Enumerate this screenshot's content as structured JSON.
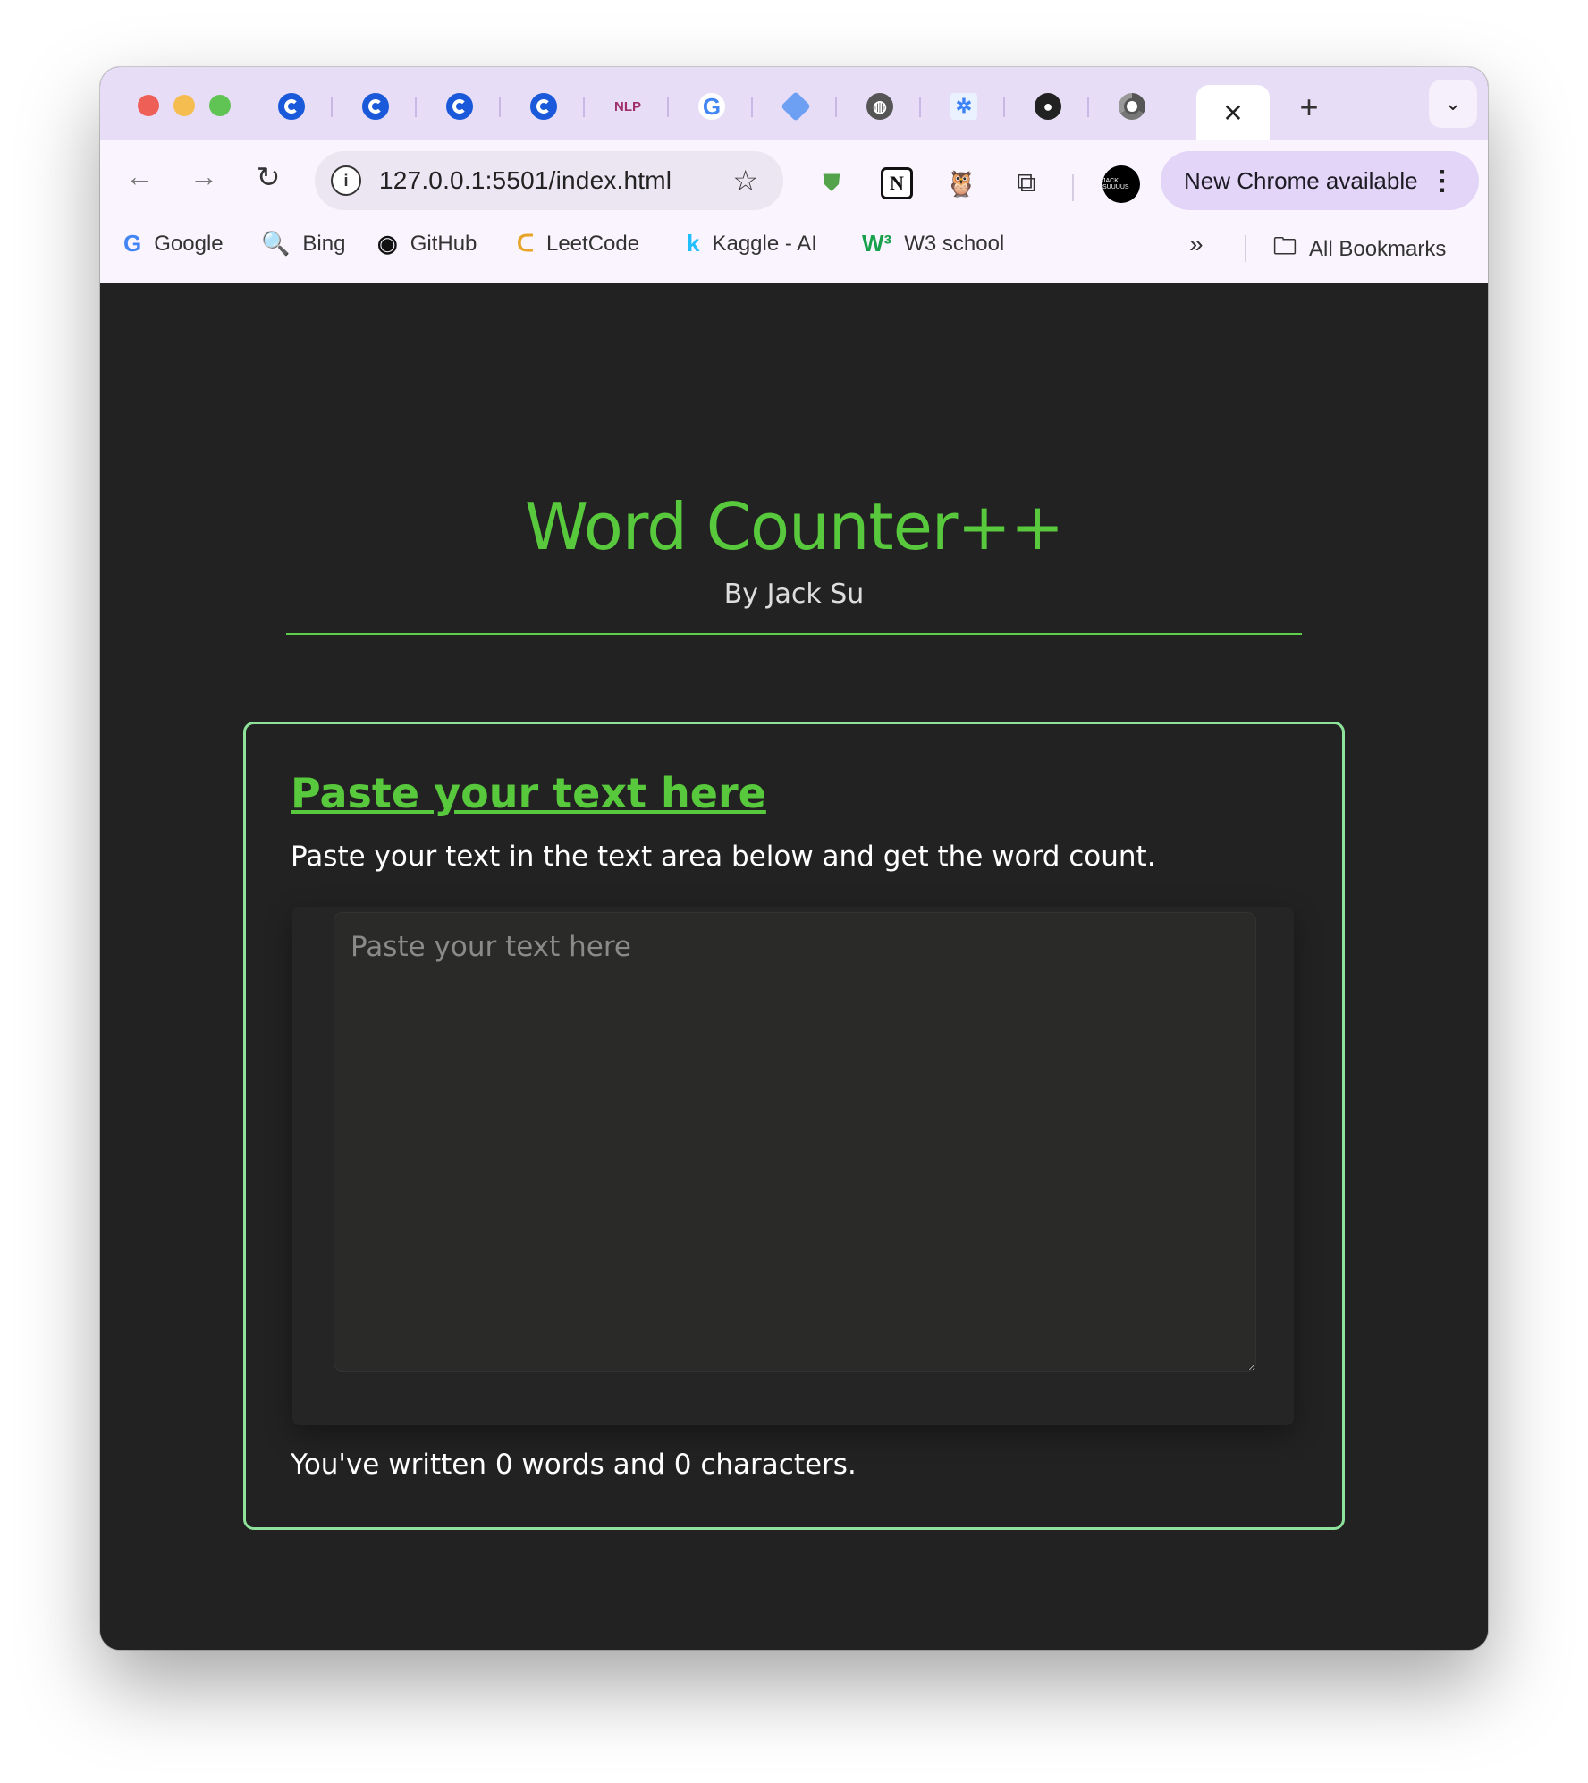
{
  "browser": {
    "tabs": [
      {
        "icon": "c-logo-icon"
      },
      {
        "icon": "c-logo-icon"
      },
      {
        "icon": "c-logo-icon"
      },
      {
        "icon": "c-logo-icon"
      },
      {
        "icon": "nlp-icon",
        "glyph": "NLP"
      },
      {
        "icon": "google-icon",
        "glyph": "G"
      },
      {
        "icon": "layers-icon"
      },
      {
        "icon": "globe-icon"
      },
      {
        "icon": "network-icon"
      },
      {
        "icon": "github-icon"
      },
      {
        "icon": "chrome-icon"
      }
    ],
    "active_tab_close": "✕",
    "new_tab": "+",
    "tab_menu": "⌄",
    "url": "127.0.0.1:5501/index.html",
    "update_label": "New Chrome available",
    "avatar_text": "JACK SUUUUS",
    "bookmarks": [
      {
        "label": "Google",
        "icon": "google-icon",
        "glyph": "G"
      },
      {
        "label": "Bing",
        "icon": "search-icon",
        "glyph": "🔍"
      },
      {
        "label": "GitHub",
        "icon": "github-icon",
        "glyph": "◉"
      },
      {
        "label": "LeetCode",
        "icon": "leetcode-icon",
        "glyph": "ᑕ"
      },
      {
        "label": "Kaggle - AI",
        "icon": "kaggle-icon",
        "glyph": "k"
      },
      {
        "label": "W3 school",
        "icon": "w3school-icon",
        "glyph": "W³"
      }
    ],
    "bookmarks_more": "»",
    "all_bookmarks": "All Bookmarks"
  },
  "page": {
    "title": "Word Counter++",
    "byline": "By Jack Su",
    "card": {
      "heading": "Paste your text here",
      "description": "Paste your text in the text area below and get the word count.",
      "textarea_placeholder": "Paste your text here",
      "textarea_value": "",
      "count_text": "You've written 0 words and 0 characters."
    }
  },
  "colors": {
    "accent_green": "#58c83c",
    "card_border": "#8ee29a",
    "page_bg": "#222222",
    "tabstrip_bg": "#e8ddf7"
  }
}
